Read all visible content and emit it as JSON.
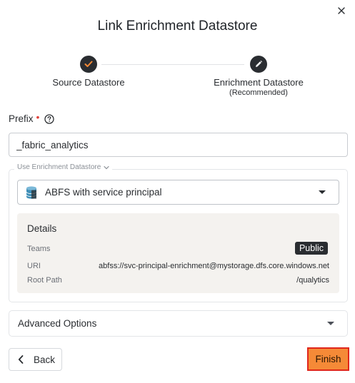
{
  "dialog": {
    "title": "Link Enrichment Datastore"
  },
  "stepper": {
    "steps": [
      {
        "label": "Source Datastore",
        "sublabel": "",
        "state": "completed",
        "icon": "check-icon"
      },
      {
        "label": "Enrichment Datastore",
        "sublabel": "(Recommended)",
        "state": "active",
        "icon": "pencil-icon"
      }
    ]
  },
  "prefix": {
    "label": "Prefix",
    "required_marker": "•",
    "value": "_fabric_analytics"
  },
  "enrichment": {
    "legend": "Use Enrichment Datastore",
    "selected": "ABFS with service principal",
    "details": {
      "title": "Details",
      "rows": [
        {
          "key": "Teams",
          "value": "Public"
        },
        {
          "key": "URI",
          "value": "abfss://svc-principal-enrichment@mystorage.dfs.core.windows.net"
        },
        {
          "key": "Root Path",
          "value": "/qualytics"
        }
      ]
    }
  },
  "advanced": {
    "label": "Advanced Options"
  },
  "footer": {
    "back_label": "Back",
    "finish_label": "Finish"
  },
  "colors": {
    "accent": "#f58a37",
    "highlight_border": "#e0261b",
    "step_fill": "#2a2d31",
    "step_check": "#f58a37",
    "details_bg": "#f4f2ef"
  }
}
